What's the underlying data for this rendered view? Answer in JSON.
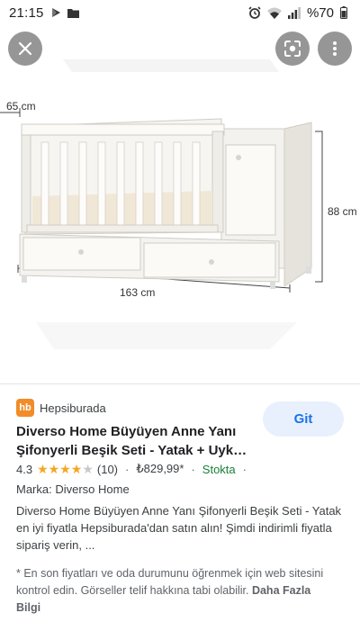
{
  "status_bar": {
    "time": "21:15",
    "battery": "%70",
    "icons": [
      "play-store-icon",
      "folder-icon",
      "alarm-icon",
      "wifi-icon",
      "signal-icon",
      "battery-icon"
    ]
  },
  "image": {
    "dimensions": {
      "width_label": "65 cm",
      "height_label": "88 cm",
      "length_label": "163 cm"
    },
    "buttons": [
      "close-icon",
      "lens-icon",
      "more-vert-icon"
    ]
  },
  "result": {
    "source": {
      "logo_text": "hb",
      "name": "Hepsiburada"
    },
    "visit_label": "Git",
    "title_line1": "Diverso Home Büyüyen Anne Yanı",
    "title_line2": "Şifonyerli Beşik Seti - Yatak + Uyk…",
    "rating": "4.3",
    "rating_value": 4.3,
    "review_count": "(10)",
    "price": "₺829,99*",
    "stock": "Stokta",
    "separator": "·",
    "brand": "Marka: Diverso Home",
    "description": "Diverso Home Büyüyen Anne Yanı Şifonyerli Beşik Seti - Yatak en iyi fiyatla Hepsiburada'dan satın alın! Şimdi indirimli fiyatla sipariş verin, ...",
    "disclaimer": "* En son fiyatları ve oda durumunu öğrenmek için web sitesini kontrol edin. Görseller telif hakkına tabi olabilir.",
    "more_info": "Daha Fazla Bilgi"
  },
  "colors": {
    "accent": "#1a73e8",
    "star": "#f5a623",
    "stock": "#188038",
    "source_logo": "#f28c28"
  }
}
